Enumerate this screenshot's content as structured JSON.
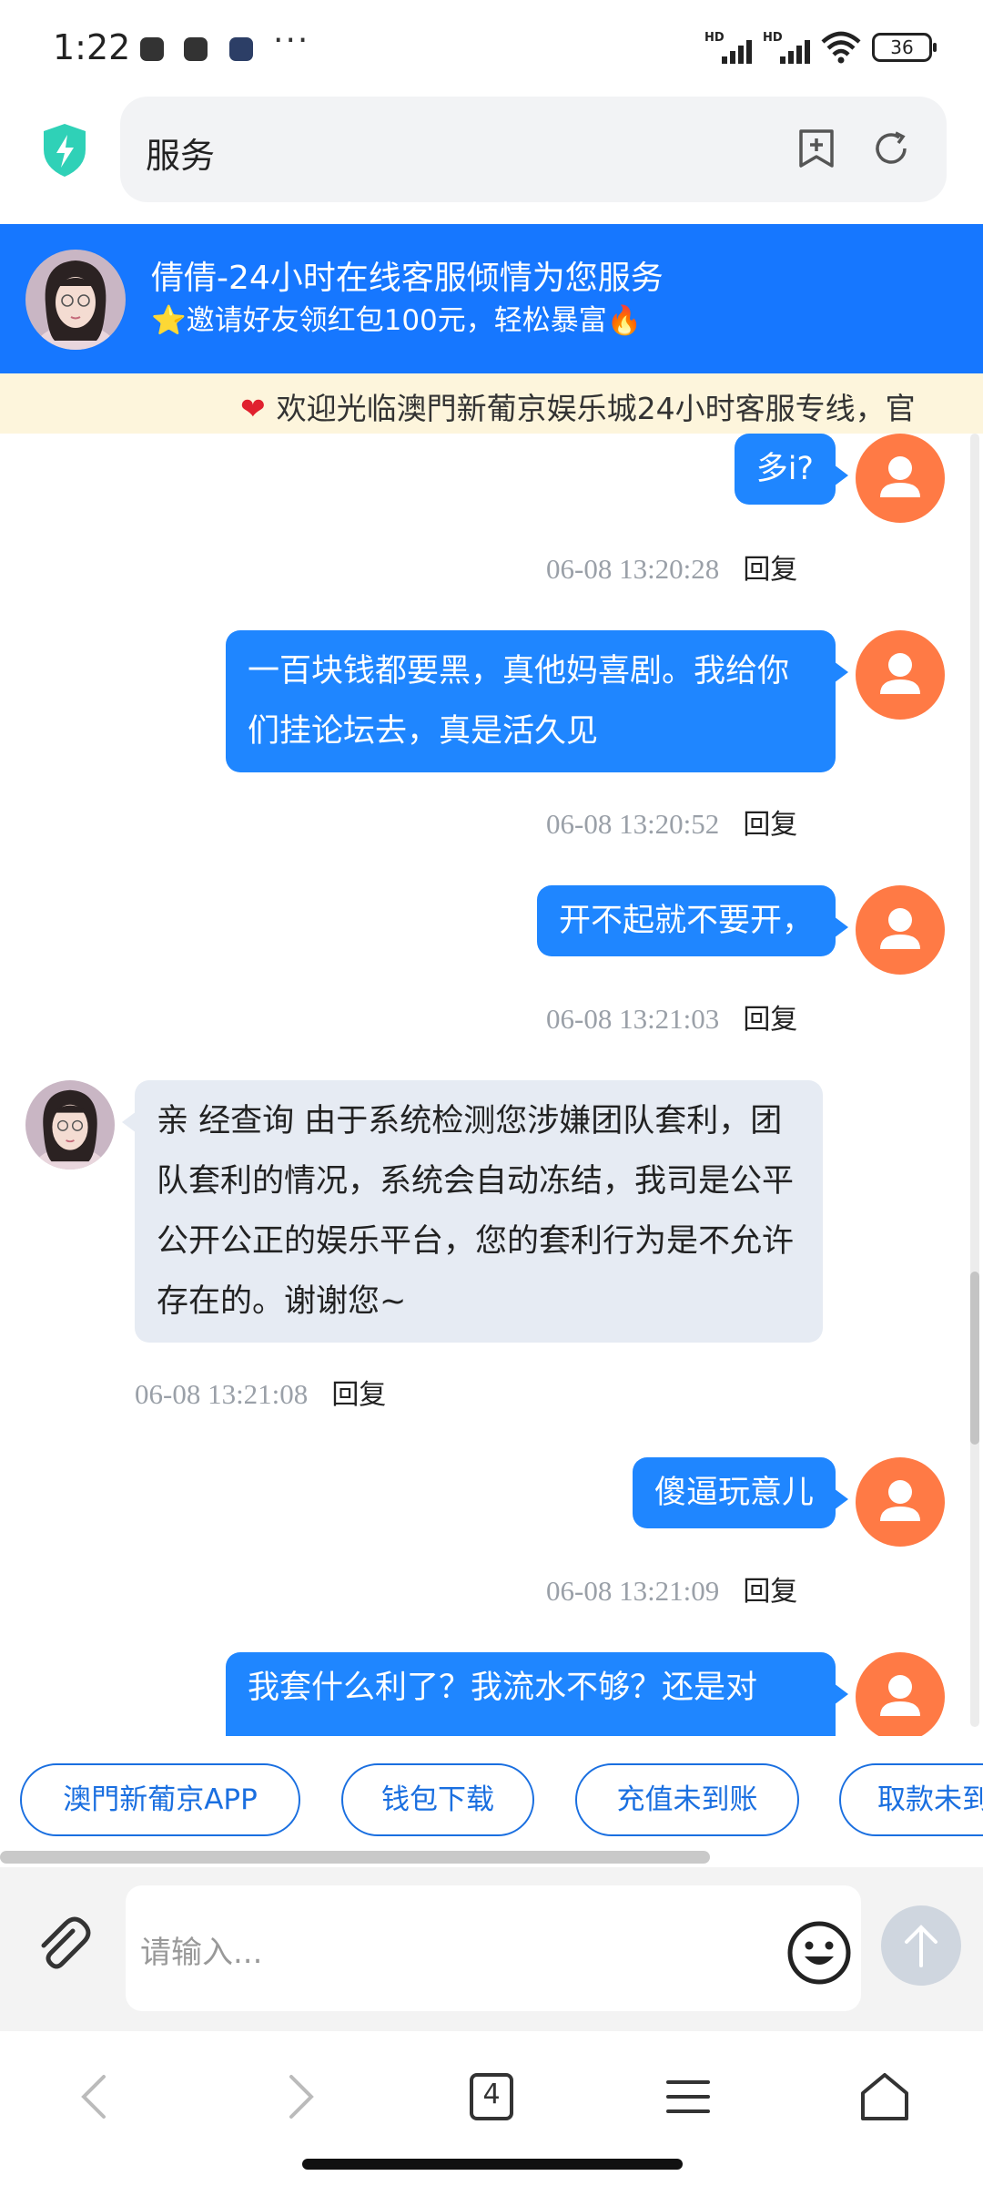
{
  "status_bar": {
    "time": "1:22",
    "more": "···",
    "signal_label_1": "HD",
    "signal_label_2": "HD",
    "battery": "36"
  },
  "browser": {
    "url_text": "服务",
    "tabs_count": "4",
    "icons": [
      "shield-icon",
      "add-bookmark-icon",
      "refresh-icon",
      "back-icon",
      "forward-icon",
      "tabs-icon",
      "menu-icon",
      "home-icon"
    ]
  },
  "chat_header": {
    "title": "倩倩-24小时在线客服倾情为您服务",
    "subtitle": "⭐邀请好友领红包100元，轻松暴富🔥"
  },
  "marquee": {
    "text": "欢迎光临澳門新葡京娱乐城24小时客服专线，官"
  },
  "messages": [
    {
      "from": "user",
      "text": "多i?",
      "time": "06-08 13:20:28",
      "reply": "回复"
    },
    {
      "from": "user",
      "text": "一百块钱都要黑，真他妈喜剧。我给你们挂论坛去，真是活久见",
      "time": "06-08 13:20:52",
      "reply": "回复"
    },
    {
      "from": "user",
      "text": "开不起就不要开，",
      "time": "06-08 13:21:03",
      "reply": "回复"
    },
    {
      "from": "agent",
      "text": "亲 经查询 由于系统检测您涉嫌团队套利，团队套利的情况，系统会自动冻结，我司是公平公开公正的娱乐平台，您的套利行为是不允许存在的。谢谢您~",
      "time": "06-08 13:21:08",
      "reply": "回复"
    },
    {
      "from": "user",
      "text": "傻逼玩意儿",
      "time": "06-08 13:21:09",
      "reply": "回复"
    },
    {
      "from": "user",
      "text": "我套什么利了？我流水不够？还是对"
    }
  ],
  "quick_replies": [
    "澳門新葡京APP",
    "钱包下载",
    "充值未到账",
    "取款未到"
  ],
  "input": {
    "placeholder": "请输入..."
  },
  "colors": {
    "header_blue": "#1677ff",
    "bubble_blue": "#1f86ff",
    "user_avatar": "#ff7a45",
    "marquee_bg": "#fdf5dc"
  }
}
